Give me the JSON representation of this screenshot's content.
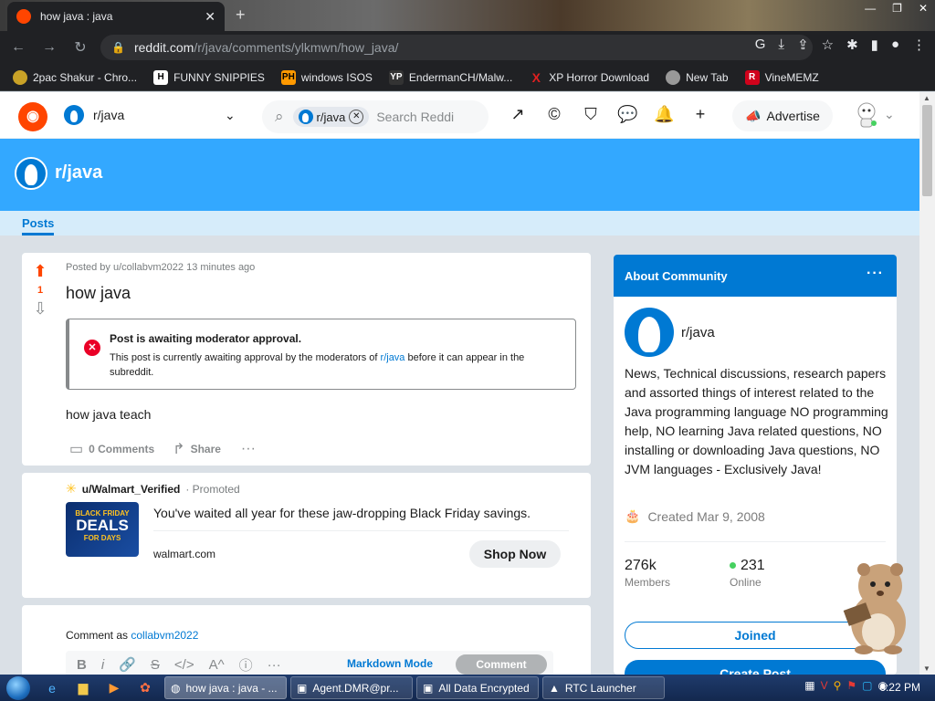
{
  "browser": {
    "tab_title": "how java : java",
    "url_host": "reddit.com",
    "url_path": "/r/java/comments/ylkmwn/how_java/",
    "bookmarks": [
      {
        "label": "2pac Shakur - Chro...",
        "icon": "record-icon",
        "color": "#c9a227"
      },
      {
        "label": "FUNNY SNIPPIES",
        "icon": "H",
        "color": "#ffffff"
      },
      {
        "label": "windows ISOS",
        "icon": "PH",
        "color": "#ff9900"
      },
      {
        "label": "EndermanCH/Malw...",
        "icon": "YP",
        "color": "#333333"
      },
      {
        "label": "XP Horror Download",
        "icon": "X",
        "color": "#e02020"
      },
      {
        "label": "New Tab",
        "icon": "globe-icon",
        "color": "#999999"
      },
      {
        "label": "VineMEMZ",
        "icon": "R",
        "color": "#d0021b"
      }
    ]
  },
  "header": {
    "community": "r/java",
    "search_chip": "r/java",
    "search_placeholder": "Search Reddi",
    "advertise": "Advertise"
  },
  "banner": {
    "name": "r/java"
  },
  "tabs": {
    "posts": "Posts"
  },
  "post": {
    "votes": "1",
    "meta": "Posted by u/collabvm2022 13 minutes ago",
    "title": "how java",
    "mod_heading": "Post is awaiting moderator approval.",
    "mod_text_before": "This post is currently awaiting approval by the moderators of ",
    "mod_link": "r/java",
    "mod_text_after": " before it can appear in the subreddit.",
    "body": "how java teach",
    "comments": "0 Comments",
    "share": "Share"
  },
  "promo": {
    "user": "u/Walmart_Verified",
    "tag": "Promoted",
    "thumb_top": "BLACK FRIDAY",
    "thumb_main": "DEALS",
    "thumb_sub": "FOR DAYS",
    "headline": "You've waited all year for these jaw-dropping Black Friday savings.",
    "domain": "walmart.com",
    "cta": "Shop Now"
  },
  "comment": {
    "as_label": "Comment as ",
    "as_user": "collabvm2022",
    "markdown": "Markdown Mode",
    "submit": "Comment"
  },
  "sidebar": {
    "title": "About Community",
    "name": "r/java",
    "description": "News, Technical discussions, research papers and assorted things of interest related to the Java programming language NO programming help, NO learning Java related questions, NO installing or downloading Java questions, NO JVM languages - Exclusively Java!",
    "created": "Created Mar 9, 2008",
    "members_value": "276k",
    "members_label": "Members",
    "online_value": "231",
    "online_label": "Online",
    "joined": "Joined",
    "create_post": "Create Post"
  },
  "taskbar": {
    "tasks": [
      "how java : java - ...",
      "Agent.DMR@pr...",
      "All Data Encrypted",
      "RTC Launcher"
    ],
    "clock": "6:22 PM"
  },
  "colors": {
    "reddit_orange": "#ff4500",
    "reddit_blue": "#0079d3",
    "banner_blue": "#33a8ff"
  }
}
